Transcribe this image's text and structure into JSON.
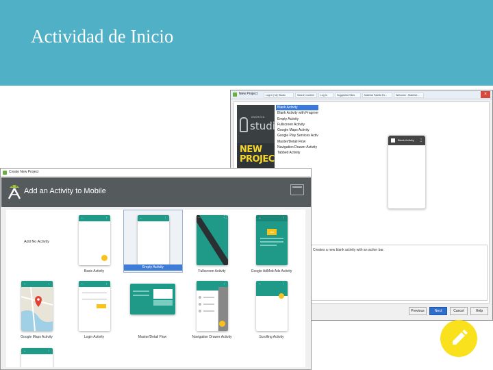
{
  "slide": {
    "title": "Actividad de Inicio"
  },
  "back_window": {
    "title": "New Project",
    "tabs": [
      "Log In | My Studio",
      "Search Content",
      "Log In",
      "Suggested Sites",
      "Material Palette Ex...",
      "Welcome - Material..."
    ],
    "close_glyph": "×",
    "logo": {
      "android_word": "ANDROID",
      "studio_word": "studio",
      "new_project_line1": "NEW",
      "new_project_line2": "PROJECT"
    },
    "activity_list": [
      "Blank Activity",
      "Blank Activity with Fragment",
      "Empty Activity",
      "Fullscreen Activity",
      "Google Maps Activity",
      "Google Play Services Activity",
      "Master/Detail Flow",
      "Navigation Drawer Activity",
      "Tabbed Activity"
    ],
    "selected_index": 0,
    "preview_label": "Blank Activity",
    "description": "Creates a new blank activity with an action bar.",
    "buttons": [
      "Previous",
      "Next",
      "Cancel",
      "Help"
    ]
  },
  "front_window": {
    "title": "Create New Project",
    "header_title": "Add an Activity to Mobile",
    "tiles": [
      {
        "label": "Add No Activity"
      },
      {
        "label": "Basic Activity"
      },
      {
        "label": "Empty Activity"
      },
      {
        "label": "Fullscreen Activity"
      },
      {
        "label": "Google AdMob Ads Activity"
      },
      {
        "label": "Google Maps Activity"
      },
      {
        "label": "Login Activity"
      },
      {
        "label": "Master/Detail Flow"
      },
      {
        "label": "Navigation Drawer Activity"
      },
      {
        "label": "Scrolling Activity"
      }
    ],
    "selected_tile": 2,
    "admob_badge": "Ad"
  },
  "colors": {
    "title_bar": "#4fb0c6",
    "teal": "#1f9a88",
    "selection_blue": "#3f7cd6",
    "fab_yellow": "#f6c21b",
    "edit_fab": "#f9e11e"
  },
  "icons": {
    "edit_fab": "pencil-icon",
    "header_right": "device-frame-icon",
    "logo": "android-studio-logo-icon"
  }
}
